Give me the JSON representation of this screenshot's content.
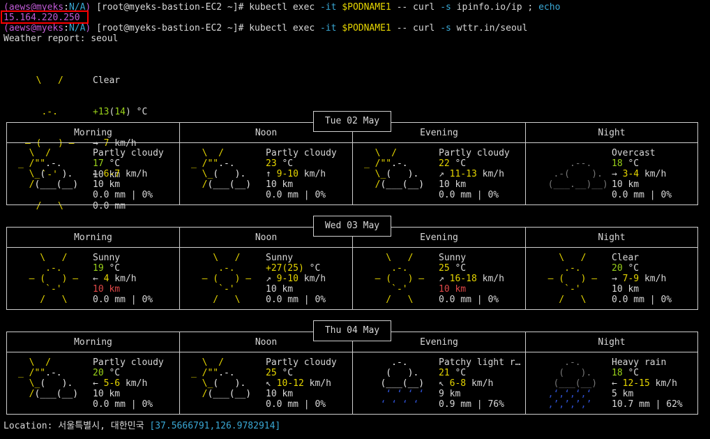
{
  "terminal": {
    "prompt_user": "aews@myeks",
    "prompt_ns": "N/A",
    "prompt_host": "[root@myeks-bastion-EC2 ~]#",
    "cmd1_pre": "kubectl exec ",
    "cmd1_flag": "-it",
    "cmd1_var": "$PODNAME1",
    "cmd1_post": " -- curl ",
    "cmd1_flag2": "-s",
    "cmd1_arg": " ipinfo.io/ip ; ",
    "cmd1_echo": "echo",
    "ip": "15.164.220.250",
    "cmd2_arg": " wttr.in/seoul",
    "weather_report": "Weather report: seoul"
  },
  "current": {
    "art": [
      "  \\   /   ",
      "   .-.    ",
      "― (   ) ― ",
      "   `-'    ",
      "  /   \\   "
    ],
    "condition": "Clear",
    "temp_main": "+13",
    "temp_feels": "14",
    "temp_unit": " °C",
    "wind_arrow": "→ ",
    "wind_speed": "7",
    "wind_unit": " km/h",
    "visibility": "10 km",
    "precip": "0.0 mm"
  },
  "days": [
    {
      "date": "Tue 02 May",
      "periods": [
        {
          "name": "Morning",
          "condition": "Partly cloudy",
          "temp": "17",
          "wind_arrow": "← ",
          "wind": "6-7",
          "vis": "10 km",
          "precip": "0.0 mm | 0%",
          "art": "partly"
        },
        {
          "name": "Noon",
          "condition": "Partly cloudy",
          "temp": "23",
          "wind_arrow": "↑ ",
          "wind": "9-10",
          "vis": "10 km",
          "precip": "0.0 mm | 0%",
          "art": "partly"
        },
        {
          "name": "Evening",
          "condition": "Partly cloudy",
          "temp": "22",
          "wind_arrow": "↗ ",
          "wind": "11-13",
          "vis": "10 km",
          "precip": "0.0 mm | 0%",
          "art": "partly"
        },
        {
          "name": "Night",
          "condition": "Overcast",
          "temp": "18",
          "wind_arrow": "→ ",
          "wind": "3-4",
          "vis": "10 km",
          "precip": "0.0 mm | 0%",
          "art": "overcast"
        }
      ]
    },
    {
      "date": "Wed 03 May",
      "periods": [
        {
          "name": "Morning",
          "condition": "Sunny",
          "temp": "19",
          "wind_arrow": "← ",
          "wind": "4",
          "vis": "10 km",
          "vis_red": true,
          "precip": "0.0 mm | 0%",
          "art": "sun"
        },
        {
          "name": "Noon",
          "condition": "Sunny",
          "temp": "+27(25)",
          "wind_arrow": "↗ ",
          "wind": "9-10",
          "vis": "10 km",
          "precip": "0.0 mm | 0%",
          "art": "sun"
        },
        {
          "name": "Evening",
          "condition": "Sunny",
          "temp": "25",
          "wind_arrow": "↗ ",
          "wind": "16-18",
          "vis": "10 km",
          "vis_red": true,
          "precip": "0.0 mm | 0%",
          "art": "sun"
        },
        {
          "name": "Night",
          "condition": "Clear",
          "temp": "20",
          "wind_arrow": "→ ",
          "wind": "7-9",
          "vis": "10 km",
          "precip": "0.0 mm | 0%",
          "art": "sun"
        }
      ]
    },
    {
      "date": "Thu 04 May",
      "periods": [
        {
          "name": "Morning",
          "condition": "Partly cloudy",
          "temp": "20",
          "wind_arrow": "← ",
          "wind": "5-6",
          "vis": "10 km",
          "precip": "0.0 mm | 0%",
          "art": "partly"
        },
        {
          "name": "Noon",
          "condition": "Partly cloudy",
          "temp": "25",
          "wind_arrow": "↖ ",
          "wind": "10-12",
          "vis": "10 km",
          "precip": "0.0 mm | 0%",
          "art": "partly"
        },
        {
          "name": "Evening",
          "condition": "Patchy light r…",
          "temp": "21",
          "wind_arrow": "↖ ",
          "wind": "6-8",
          "vis": "9 km",
          "precip": "0.9 mm | 76%",
          "art": "lightrain"
        },
        {
          "name": "Night",
          "condition": "Heavy rain",
          "temp": "18",
          "wind_arrow": "← ",
          "wind": "12-15",
          "vis": "5 km",
          "precip": "10.7 mm | 62%",
          "art": "heavyrain"
        }
      ]
    }
  ],
  "location": {
    "label": "Location: ",
    "name": "서울특별시, 대한민국",
    "coords": "[37.5666791,126.9782914]"
  },
  "colors": {
    "prompt": "#c25bd6",
    "namespace": "#3aa9d6",
    "ip_box": "#ff0000",
    "sun": "#e6d600",
    "temp_cool": "#9ad21a",
    "rain": "#2f52d6"
  }
}
